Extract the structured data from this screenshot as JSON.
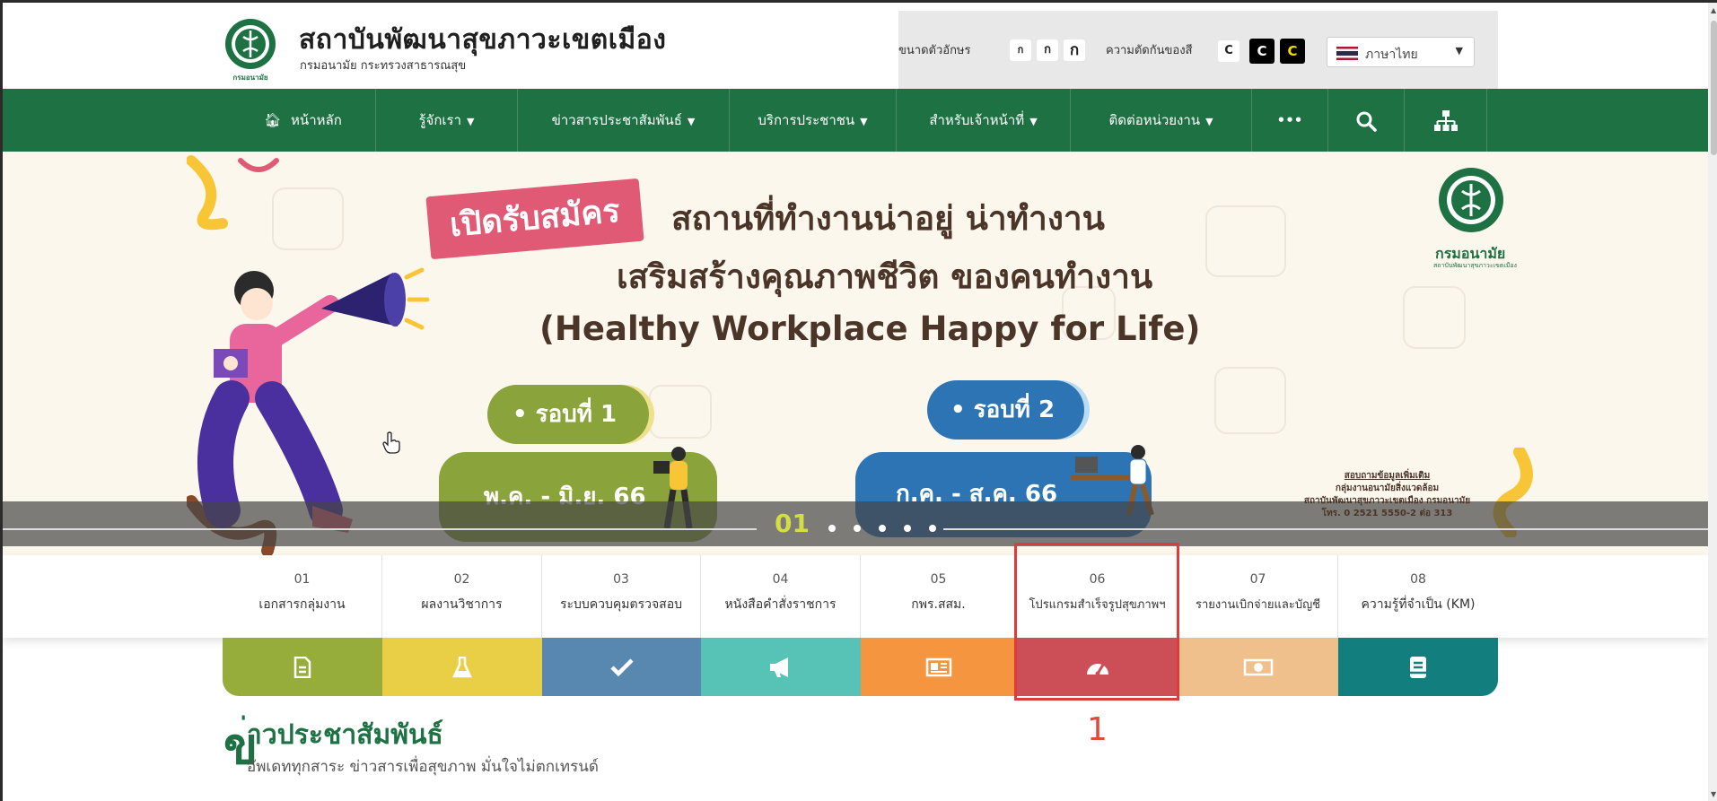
{
  "header": {
    "title": "สถาบันพัฒนาสุขภาวะเขตเมือง",
    "subtitle": "กรมอนามัย กระทรวงสาธารณสุข",
    "logo_text": "กรมอนามัย"
  },
  "toolbar": {
    "font_size_label": "ขนาดตัวอักษร",
    "font_sizes": [
      "ก",
      "ก",
      "ก"
    ],
    "contrast_label": "ความตัดกันของสี",
    "contrast": [
      "C",
      "C",
      "C"
    ],
    "language": "ภาษาไทย"
  },
  "nav": {
    "items": [
      {
        "label": "หน้าหลัก",
        "icon": "home-icon"
      },
      {
        "label": "รู้จักเรา"
      },
      {
        "label": "ข่าวสารประชาสัมพันธ์"
      },
      {
        "label": "บริการประชาชน"
      },
      {
        "label": "สำหรับเจ้าหน้าที่"
      },
      {
        "label": "ติดต่อหน่วยงาน"
      },
      {
        "label": "•••"
      }
    ],
    "icons": [
      "search-icon",
      "sitemap-icon"
    ]
  },
  "banner": {
    "open_label": "เปิดรับสมัคร",
    "line1": "สถานที่ทำงานน่าอยู่ น่าทำงาน",
    "line2": "เสริมสร้างคุณภาพชีวิต ของคนทำงาน",
    "line3": "(Healthy Workplace Happy for Life)",
    "round1": "• รอบที่ 1",
    "round2": "• รอบที่ 2",
    "date1": "พ.ค. - มิ.ย. 66",
    "date2": "ก.ค. - ส.ค. 66",
    "ministry": "กรมอนามัย",
    "ministry_sub": "สถาบันพัฒนาสุขภาวะเขตเมือง",
    "contact_lines": [
      "สอบถามข้อมูลเพิ่มเติม",
      "กลุ่มงานอนามัยสิ่งแวดล้อม",
      "สถาบันพัฒนาสุขภาวะเขตเมือง กรมอนามัย",
      "โทร. 0 2521 5550-2 ต่อ 313"
    ],
    "slide_number": "01",
    "slide_count": 5
  },
  "tabs": [
    {
      "num": "01",
      "label": "เอกสารกลุ่มงาน",
      "color": "#96ad3b",
      "icon": "document-icon"
    },
    {
      "num": "02",
      "label": "ผลงานวิชาการ",
      "color": "#e8cf45",
      "icon": "flask-icon"
    },
    {
      "num": "03",
      "label": "ระบบควบคุมตรวจสอบ",
      "color": "#5888b0",
      "icon": "check-icon"
    },
    {
      "num": "04",
      "label": "หนังสือคำสั่งราชการ",
      "color": "#56c3b6",
      "icon": "megaphone-icon"
    },
    {
      "num": "05",
      "label": "กพร.สสม.",
      "color": "#f59540",
      "icon": "newspaper-icon"
    },
    {
      "num": "06",
      "label": "โปรแกรมสำเร็จรูปสุขภาพฯ",
      "color": "#cc4f57",
      "icon": "gauge-icon"
    },
    {
      "num": "07",
      "label": "รายงานเบิกจ่ายและบัญชี",
      "color": "#f0c08c",
      "icon": "money-icon"
    },
    {
      "num": "08",
      "label": "ความรู้ที่จำเป็น (KM)",
      "color": "#127f7e",
      "icon": "book-icon"
    }
  ],
  "annotation": "1",
  "news": {
    "initial": "ข",
    "title": "่าวประชาสัมพันธ์",
    "subtitle": "อัพเดททุกสาระ ข่าวสารเพื่อสุขภาพ มั่นใจไม่ตกเทรนด์"
  }
}
